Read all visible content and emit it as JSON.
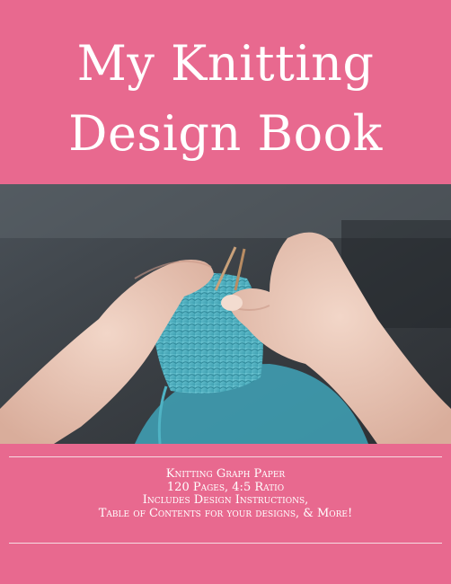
{
  "cover": {
    "title_line1": "My Knitting",
    "title_line2": "Design Book",
    "subtitle_lines": [
      "Knitting Graph Paper",
      "120 Pages, 4:5 Ratio",
      "Includes Design Instructions,",
      "Table of Contents for your designs, & More!"
    ],
    "colors": {
      "background": "#e8698f",
      "text": "#ffffff",
      "yarn": "#4fb3c4"
    },
    "photo_description_icon": "hands-knitting-image"
  }
}
